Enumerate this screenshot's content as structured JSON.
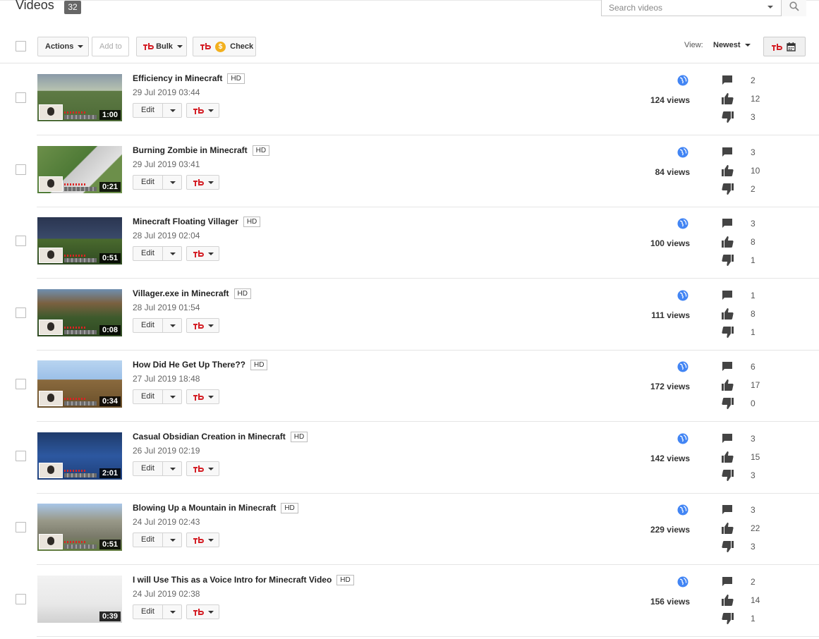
{
  "header": {
    "title": "Videos",
    "count": "32",
    "search_placeholder": "Search videos"
  },
  "toolbar": {
    "actions_label": "Actions",
    "add_to_label": "Add to",
    "bulk_label": "Bulk",
    "check_label": "Check",
    "view_label": "View:",
    "view_value": "Newest"
  },
  "colors": {
    "brand_red": "#d41f26",
    "globe_blue": "#4285f4",
    "coin_gold": "#f2b01e"
  },
  "videos": [
    {
      "title": "Efficiency in Minecraft",
      "quality": "HD",
      "date": "29 Jul 2019 03:44",
      "duration": "1:00",
      "views": "124 views",
      "comments": "2",
      "likes": "12",
      "dislikes": "3",
      "edit_label": "Edit"
    },
    {
      "title": "Burning Zombie in Minecraft",
      "quality": "HD",
      "date": "29 Jul 2019 03:41",
      "duration": "0:21",
      "views": "84 views",
      "comments": "3",
      "likes": "10",
      "dislikes": "2",
      "edit_label": "Edit"
    },
    {
      "title": "Minecraft Floating Villager",
      "quality": "HD",
      "date": "28 Jul 2019 02:04",
      "duration": "0:51",
      "views": "100 views",
      "comments": "3",
      "likes": "8",
      "dislikes": "1",
      "edit_label": "Edit"
    },
    {
      "title": "Villager.exe in Minecraft",
      "quality": "HD",
      "date": "28 Jul 2019 01:54",
      "duration": "0:08",
      "views": "111 views",
      "comments": "1",
      "likes": "8",
      "dislikes": "1",
      "edit_label": "Edit"
    },
    {
      "title": "How Did He Get Up There??",
      "quality": "HD",
      "date": "27 Jul 2019 18:48",
      "duration": "0:34",
      "views": "172 views",
      "comments": "6",
      "likes": "17",
      "dislikes": "0",
      "edit_label": "Edit"
    },
    {
      "title": "Casual Obsidian Creation in Minecraft",
      "quality": "HD",
      "date": "26 Jul 2019 02:19",
      "duration": "2:01",
      "views": "142 views",
      "comments": "3",
      "likes": "15",
      "dislikes": "3",
      "edit_label": "Edit"
    },
    {
      "title": "Blowing Up a Mountain in Minecraft",
      "quality": "HD",
      "date": "24 Jul 2019 02:43",
      "duration": "0:51",
      "views": "229 views",
      "comments": "3",
      "likes": "22",
      "dislikes": "3",
      "edit_label": "Edit"
    },
    {
      "title": "I will Use This as a Voice Intro for Minecraft Video",
      "quality": "HD",
      "date": "24 Jul 2019 02:38",
      "duration": "0:39",
      "views": "156 views",
      "comments": "2",
      "likes": "14",
      "dislikes": "1",
      "edit_label": "Edit"
    }
  ]
}
